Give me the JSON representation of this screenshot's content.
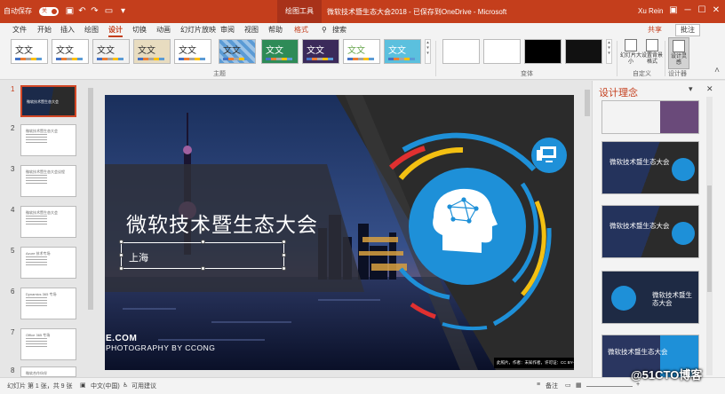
{
  "titlebar": {
    "autosave": "自动保存",
    "autosave_toggle": "关",
    "context_tab": "绘图工具",
    "doc_title": "微软技术暨生态大会2018 - 已保存到OneDrive - Microsoft",
    "user": "Xu Rein",
    "search": "搜索"
  },
  "tabs": [
    "文件",
    "开始",
    "插入",
    "绘图",
    "设计",
    "切换",
    "动画",
    "幻灯片放映",
    "审阅",
    "视图",
    "帮助",
    "格式"
  ],
  "share": "共享",
  "comment": "批注",
  "ribbon": {
    "theme_label": "文文",
    "group_themes": "主题",
    "group_variants": "变体",
    "group_customize": "自定义",
    "group_designer": "设计器",
    "btn_slide_size": "幻灯片大小",
    "btn_bg_format": "设置背景格式",
    "btn_design_ideas": "设计灵感"
  },
  "thumbs": [
    {
      "n": "1",
      "title": "微软技术暨生态大会"
    },
    {
      "n": "2",
      "title": "微软技术暨生态大会"
    },
    {
      "n": "3",
      "title": "微软技术暨生态大会议程"
    },
    {
      "n": "4",
      "title": "微软技术暨生态大会"
    },
    {
      "n": "5",
      "title": "Azure 技术专场"
    },
    {
      "n": "6",
      "title": "Dynamics 365 专场"
    },
    {
      "n": "7",
      "title": "Office 365 专场"
    },
    {
      "n": "8",
      "title": "微软合作伙伴"
    }
  ],
  "slide": {
    "title": "微软技术暨生态大会",
    "subtitle": "上海",
    "credit1": "E.COM",
    "credit2": "PHOTOGRAPHY BY CCONG",
    "caption": "此照片，作者：未知作者，许可证：CC BY-SA-NC"
  },
  "pane": {
    "title": "设计理念",
    "pin": "▾",
    "close": "✕",
    "ideas": [
      "微软技术暨生态大会",
      "微软技术暨生态大会",
      "微软技术暨生态大会",
      "微软技术暨生态大会"
    ]
  },
  "status": {
    "slide": "幻灯片 第 1 张，共 9 张",
    "lang": "中文(中国)",
    "access": "可用建议",
    "notes": "备注",
    "zoom": "+"
  },
  "watermark": "@51CTO博客"
}
